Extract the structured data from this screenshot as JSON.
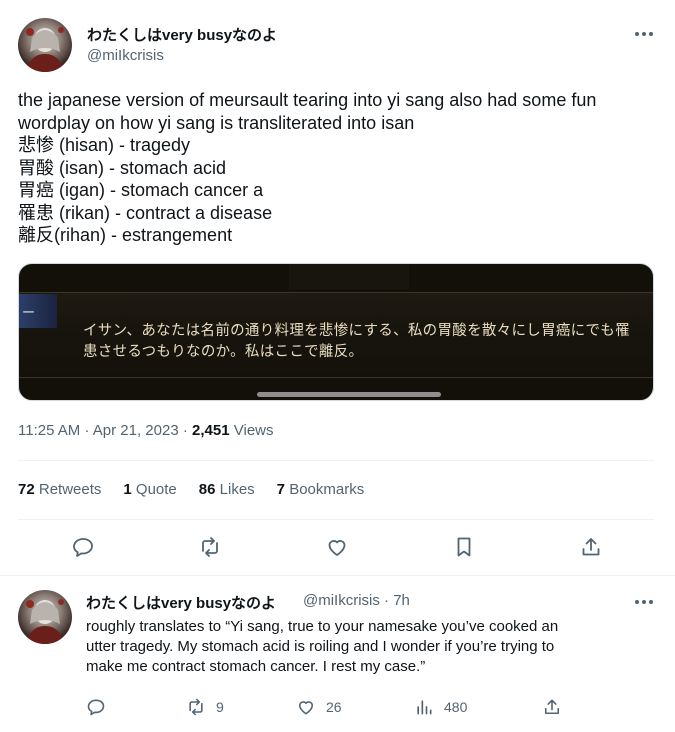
{
  "tweet": {
    "display_name": "わたくしはvery busyなのよ",
    "handle": "@miIkcrisis",
    "text_lines": [
      "the japanese version of meursault tearing into yi sang also had some fun",
      "wordplay on how yi sang is transliterated into isan",
      "悲惨 (hisan) - tragedy",
      "胃酸 (isan) - stomach acid",
      "胃癌 (igan) - stomach cancer a",
      "罹患 (rikan) - contract a disease",
      "離反(rihan) - estrangement"
    ],
    "media": {
      "tag": "ー",
      "subtitle_lines": [
        "イサン、あなたは名前の通り料理を悲惨にする、私の胃酸を散々にし胃癌にでも罹",
        "患させるつもりなのか。私はここで離反。"
      ]
    },
    "time": "11:25 AM",
    "date": "Apr 21, 2023",
    "views_count": "2,451",
    "views_label": "Views",
    "stats": {
      "retweets_count": "72",
      "retweets_label": "Retweets",
      "quotes_count": "1",
      "quotes_label": "Quote",
      "likes_count": "86",
      "likes_label": "Likes",
      "bookmarks_count": "7",
      "bookmarks_label": "Bookmarks"
    },
    "icons": [
      "reply-icon",
      "retweet-icon",
      "like-icon",
      "bookmark-icon",
      "share-icon",
      "more-icon"
    ]
  },
  "reply": {
    "display_name": "わたくしはvery busyなのよ",
    "handle_time": "@miIkcrisis · 7h",
    "text_lines": [
      "roughly translates to “Yi sang, true to your namesake you’ve cooked an",
      "utter tragedy. My stomach acid is roiling and I wonder if you’re trying to",
      "make me contract stomach cancer. I rest my case.”"
    ],
    "retweets": "9",
    "likes": "26",
    "views": "480"
  },
  "colors": {
    "text": "#0f1419",
    "secondary": "#536471",
    "divider": "#eff3f4"
  }
}
